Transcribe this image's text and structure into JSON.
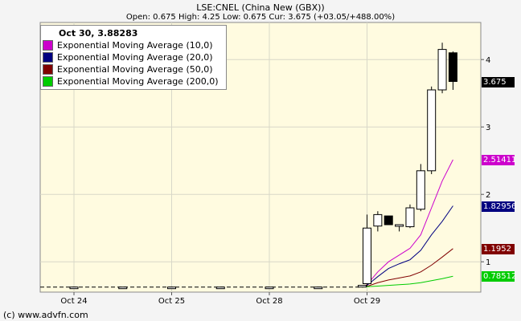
{
  "title": "LSE:CNEL (China New (GBX))",
  "subtitle": "Open: 0.675  High: 4.25  Low: 0.675  Cur: 3.675 (+03.05/+488.00%)",
  "copyright": "(c) www.advfn.com",
  "legend": {
    "header": "Oct 30, 3.88283",
    "items": [
      {
        "label": "Exponential Moving Average (10,0)",
        "color": "#cc00cc"
      },
      {
        "label": "Exponential Moving Average (20,0)",
        "color": "#000080"
      },
      {
        "label": "Exponential Moving Average (50,0)",
        "color": "#800000"
      },
      {
        "label": "Exponential Moving Average (200,0)",
        "color": "#00cc00"
      }
    ]
  },
  "value_labels": [
    {
      "text": "3.675",
      "value": 3.675,
      "bg": "#000000",
      "fg": "#ffffff"
    },
    {
      "text": "2.51411",
      "value": 2.51411,
      "bg": "#cc00cc",
      "fg": "#ffffff"
    },
    {
      "text": "1.82956",
      "value": 1.82956,
      "bg": "#000080",
      "fg": "#ffffff"
    },
    {
      "text": "1.1952",
      "value": 1.1952,
      "bg": "#800000",
      "fg": "#ffffff"
    },
    {
      "text": "0.78512",
      "value": 0.78512,
      "bg": "#00cc00",
      "fg": "#ffffff"
    }
  ],
  "chart_data": {
    "type": "candlestick",
    "ylim": [
      0.55,
      4.55
    ],
    "yticks": [
      1,
      2,
      3,
      4
    ],
    "x_categories": [
      "Oct 24",
      "Oct 25",
      "Oct 28",
      "Oct 29",
      "Oct 30"
    ],
    "xtick_labels": [
      "Oct 24",
      "Oct 25",
      "Oct 28",
      "Oct 29"
    ],
    "grid": true,
    "background": "#fffbe0",
    "candles": [
      {
        "x": 0.0,
        "open": 0.625,
        "high": 0.625,
        "low": 0.625,
        "close": 0.625
      },
      {
        "x": 0.5,
        "open": 0.625,
        "high": 0.625,
        "low": 0.625,
        "close": 0.625
      },
      {
        "x": 1.0,
        "open": 0.61,
        "high": 0.625,
        "low": 0.6,
        "close": 0.625
      },
      {
        "x": 1.5,
        "open": 0.625,
        "high": 0.625,
        "low": 0.625,
        "close": 0.625
      },
      {
        "x": 2.0,
        "open": 0.625,
        "high": 0.625,
        "low": 0.625,
        "close": 0.625
      },
      {
        "x": 2.5,
        "open": 0.625,
        "high": 0.625,
        "low": 0.625,
        "close": 0.625
      },
      {
        "x": 2.95,
        "open": 0.625,
        "high": 0.65,
        "low": 0.625,
        "close": 0.65
      },
      {
        "x": 3.0,
        "open": 0.675,
        "high": 1.7,
        "low": 0.64,
        "close": 1.5
      },
      {
        "x": 3.11,
        "open": 1.53,
        "high": 1.75,
        "low": 1.45,
        "close": 1.7
      },
      {
        "x": 3.22,
        "open": 1.68,
        "high": 1.68,
        "low": 1.55,
        "close": 1.55
      },
      {
        "x": 3.33,
        "open": 1.55,
        "high": 1.55,
        "low": 1.45,
        "close": 1.55
      },
      {
        "x": 3.44,
        "open": 1.52,
        "high": 1.85,
        "low": 1.5,
        "close": 1.8
      },
      {
        "x": 3.55,
        "open": 1.78,
        "high": 2.45,
        "low": 1.75,
        "close": 2.35
      },
      {
        "x": 3.66,
        "open": 2.35,
        "high": 3.6,
        "low": 2.3,
        "close": 3.55
      },
      {
        "x": 3.77,
        "open": 3.55,
        "high": 4.25,
        "low": 3.5,
        "close": 4.15
      },
      {
        "x": 3.88,
        "open": 4.1,
        "high": 4.12,
        "low": 3.55,
        "close": 3.675
      }
    ],
    "series": [
      {
        "name": "Exponential Moving Average (10,0)",
        "color": "#cc00cc",
        "x": [
          2.95,
          3.0,
          3.11,
          3.22,
          3.33,
          3.44,
          3.55,
          3.66,
          3.77,
          3.88
        ],
        "values": [
          0.625,
          0.66,
          0.85,
          1.0,
          1.1,
          1.2,
          1.4,
          1.8,
          2.2,
          2.51411
        ]
      },
      {
        "name": "Exponential Moving Average (20,0)",
        "color": "#000080",
        "x": [
          2.95,
          3.0,
          3.11,
          3.22,
          3.33,
          3.44,
          3.55,
          3.66,
          3.77,
          3.88
        ],
        "values": [
          0.625,
          0.65,
          0.78,
          0.9,
          0.97,
          1.03,
          1.17,
          1.4,
          1.6,
          1.82956
        ]
      },
      {
        "name": "Exponential Moving Average (50,0)",
        "color": "#800000",
        "x": [
          2.95,
          3.0,
          3.11,
          3.22,
          3.33,
          3.44,
          3.55,
          3.66,
          3.77,
          3.88
        ],
        "values": [
          0.625,
          0.635,
          0.69,
          0.73,
          0.76,
          0.79,
          0.85,
          0.95,
          1.07,
          1.1952
        ]
      },
      {
        "name": "Exponential Moving Average (200,0)",
        "color": "#00cc00",
        "x": [
          2.95,
          3.0,
          3.11,
          3.22,
          3.33,
          3.44,
          3.55,
          3.66,
          3.77,
          3.88
        ],
        "values": [
          0.625,
          0.63,
          0.64,
          0.65,
          0.66,
          0.67,
          0.69,
          0.72,
          0.75,
          0.78512
        ]
      }
    ]
  }
}
